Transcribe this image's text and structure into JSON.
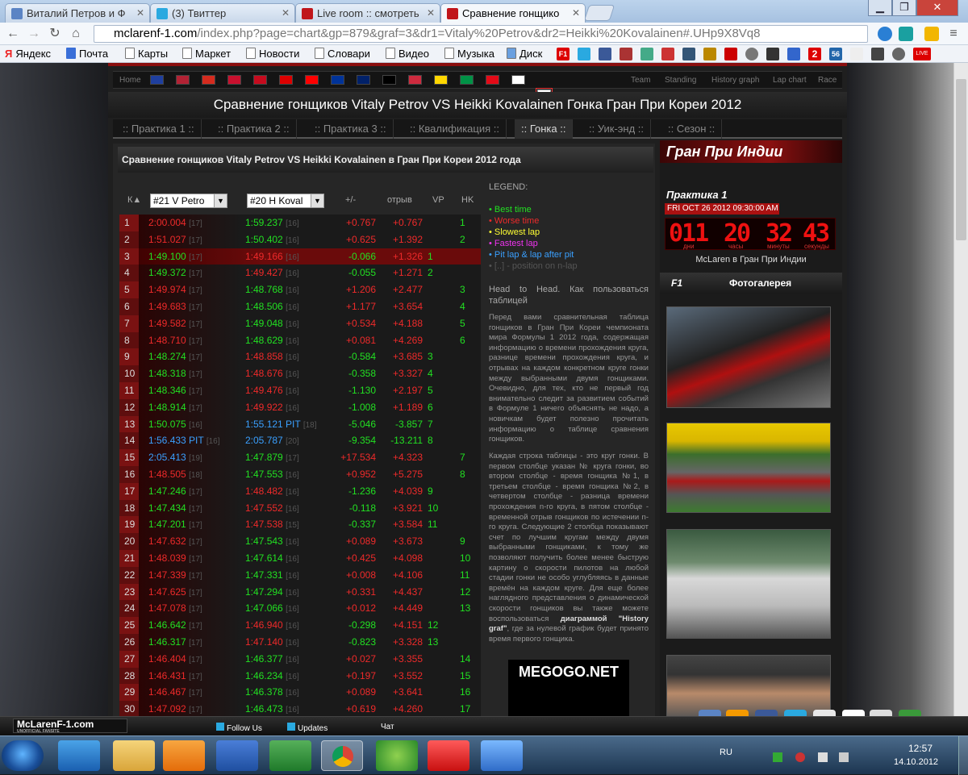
{
  "browser": {
    "tabs": [
      {
        "title": "Виталий Петров и Ф",
        "color": "#5b84c4"
      },
      {
        "title": "(3) Твиттер",
        "color": "#2aa9e0"
      },
      {
        "title": "Live room :: смотреть",
        "color": "#c0161b"
      },
      {
        "title": "Сравнение гонщико",
        "color": "#c0161b"
      }
    ],
    "url_host": "mclarenf-1.com",
    "url_path": "/index.php?page=chart&gp=879&graf=3&dr1=Vitaly%20Petrov&dr2=Heikki%20Kovalainen#.UHp9X8Vq8",
    "bookmarks": [
      "Яндекс",
      "Почта",
      "Карты",
      "Маркет",
      "Новости",
      "Словари",
      "Видео",
      "Музыка",
      "Диск"
    ],
    "bm_icons": [
      "F1",
      "2",
      "56",
      "LIVE"
    ]
  },
  "site": {
    "menu_left": "Home",
    "menu_right": [
      "Team",
      "Standing",
      "History graph",
      "Lap chart",
      "Race"
    ],
    "flag_colors": [
      "#1f3f9f",
      "#b22234",
      "#d52b1e",
      "#c8102e",
      "#c60b1e",
      "#dd0000",
      "#ff0000",
      "#003399",
      "#012169",
      "#000000",
      "#cd2a3e",
      "#ffd700",
      "#009246",
      "#e30a17",
      "#ffffff",
      "#ffffff"
    ],
    "title": "Сравнение гонщиков Vitaly Petrov VS Heikki Kovalainen Гонка Гран При Кореи 2012",
    "sessions": [
      ":: Практика 1 ::",
      ":: Практика 2 ::",
      ":: Практика 3 ::",
      ":: Квалификация ::",
      ":: Гонка ::",
      ":: Уик-энд ::",
      ":: Сезон ::"
    ],
    "content_header": "Сравнение гонщиков Vitaly Petrov VS Heikki Kovalainen в Гран При Кореи 2012 года"
  },
  "table": {
    "col_k": "К",
    "driver1": "#21 V Petro",
    "driver2": "#20 H Koval",
    "col_diff": "+/-",
    "col_gap": "отрыв",
    "col_vp": "VP",
    "col_hk": "HK",
    "rows": [
      {
        "k": "1",
        "t1": "2:00.004",
        "p1": "[17]",
        "c1": "r",
        "t2": "1:59.237",
        "p2": "[16]",
        "c2": "g",
        "d": "+0.767",
        "dc": "r",
        "g": "+0.767",
        "gc": "r",
        "vp": "",
        "hk": "1"
      },
      {
        "k": "2",
        "t1": "1:51.027",
        "p1": "[17]",
        "c1": "r",
        "t2": "1:50.402",
        "p2": "[16]",
        "c2": "g",
        "d": "+0.625",
        "dc": "r",
        "g": "+1.392",
        "gc": "r",
        "vp": "",
        "hk": "2"
      },
      {
        "k": "3",
        "t1": "1:49.100",
        "p1": "[17]",
        "c1": "g",
        "t2": "1:49.166",
        "p2": "[16]",
        "c2": "r",
        "d": "-0.066",
        "dc": "g",
        "g": "+1.326",
        "gc": "r",
        "vp": "1",
        "hk": "",
        "hl": true
      },
      {
        "k": "4",
        "t1": "1:49.372",
        "p1": "[17]",
        "c1": "g",
        "t2": "1:49.427",
        "p2": "[16]",
        "c2": "r",
        "d": "-0.055",
        "dc": "g",
        "g": "+1.271",
        "gc": "r",
        "vp": "2",
        "hk": ""
      },
      {
        "k": "5",
        "t1": "1:49.974",
        "p1": "[17]",
        "c1": "r",
        "t2": "1:48.768",
        "p2": "[16]",
        "c2": "g",
        "d": "+1.206",
        "dc": "r",
        "g": "+2.477",
        "gc": "r",
        "vp": "",
        "hk": "3"
      },
      {
        "k": "6",
        "t1": "1:49.683",
        "p1": "[17]",
        "c1": "r",
        "t2": "1:48.506",
        "p2": "[16]",
        "c2": "g",
        "d": "+1.177",
        "dc": "r",
        "g": "+3.654",
        "gc": "r",
        "vp": "",
        "hk": "4"
      },
      {
        "k": "7",
        "t1": "1:49.582",
        "p1": "[17]",
        "c1": "r",
        "t2": "1:49.048",
        "p2": "[16]",
        "c2": "g",
        "d": "+0.534",
        "dc": "r",
        "g": "+4.188",
        "gc": "r",
        "vp": "",
        "hk": "5"
      },
      {
        "k": "8",
        "t1": "1:48.710",
        "p1": "[17]",
        "c1": "r",
        "t2": "1:48.629",
        "p2": "[16]",
        "c2": "g",
        "d": "+0.081",
        "dc": "r",
        "g": "+4.269",
        "gc": "r",
        "vp": "",
        "hk": "6"
      },
      {
        "k": "9",
        "t1": "1:48.274",
        "p1": "[17]",
        "c1": "g",
        "t2": "1:48.858",
        "p2": "[16]",
        "c2": "r",
        "d": "-0.584",
        "dc": "g",
        "g": "+3.685",
        "gc": "r",
        "vp": "3",
        "hk": ""
      },
      {
        "k": "10",
        "t1": "1:48.318",
        "p1": "[17]",
        "c1": "g",
        "t2": "1:48.676",
        "p2": "[16]",
        "c2": "r",
        "d": "-0.358",
        "dc": "g",
        "g": "+3.327",
        "gc": "r",
        "vp": "4",
        "hk": ""
      },
      {
        "k": "11",
        "t1": "1:48.346",
        "p1": "[17]",
        "c1": "g",
        "t2": "1:49.476",
        "p2": "[16]",
        "c2": "r",
        "d": "-1.130",
        "dc": "g",
        "g": "+2.197",
        "gc": "r",
        "vp": "5",
        "hk": ""
      },
      {
        "k": "12",
        "t1": "1:48.914",
        "p1": "[17]",
        "c1": "g",
        "t2": "1:49.922",
        "p2": "[16]",
        "c2": "r",
        "d": "-1.008",
        "dc": "g",
        "g": "+1.189",
        "gc": "r",
        "vp": "6",
        "hk": ""
      },
      {
        "k": "13",
        "t1": "1:50.075",
        "p1": "[16]",
        "c1": "g",
        "t2": "1:55.121 PIT",
        "p2": "[18]",
        "c2": "b",
        "d": "-5.046",
        "dc": "g",
        "g": "-3.857",
        "gc": "g",
        "vp": "7",
        "hk": ""
      },
      {
        "k": "14",
        "t1": "1:56.433 PIT",
        "p1": "[16]",
        "c1": "b",
        "t2": "2:05.787",
        "p2": "[20]",
        "c2": "b",
        "d": "-9.354",
        "dc": "g",
        "g": "-13.211",
        "gc": "g",
        "vp": "8",
        "hk": ""
      },
      {
        "k": "15",
        "t1": "2:05.413",
        "p1": "[19]",
        "c1": "b",
        "t2": "1:47.879",
        "p2": "[17]",
        "c2": "g",
        "d": "+17.534",
        "dc": "r",
        "g": "+4.323",
        "gc": "r",
        "vp": "",
        "hk": "7"
      },
      {
        "k": "16",
        "t1": "1:48.505",
        "p1": "[18]",
        "c1": "r",
        "t2": "1:47.553",
        "p2": "[16]",
        "c2": "g",
        "d": "+0.952",
        "dc": "r",
        "g": "+5.275",
        "gc": "r",
        "vp": "",
        "hk": "8"
      },
      {
        "k": "17",
        "t1": "1:47.246",
        "p1": "[17]",
        "c1": "g",
        "t2": "1:48.482",
        "p2": "[16]",
        "c2": "r",
        "d": "-1.236",
        "dc": "g",
        "g": "+4.039",
        "gc": "r",
        "vp": "9",
        "hk": ""
      },
      {
        "k": "18",
        "t1": "1:47.434",
        "p1": "[17]",
        "c1": "g",
        "t2": "1:47.552",
        "p2": "[16]",
        "c2": "r",
        "d": "-0.118",
        "dc": "g",
        "g": "+3.921",
        "gc": "r",
        "vp": "10",
        "hk": ""
      },
      {
        "k": "19",
        "t1": "1:47.201",
        "p1": "[17]",
        "c1": "g",
        "t2": "1:47.538",
        "p2": "[15]",
        "c2": "r",
        "d": "-0.337",
        "dc": "g",
        "g": "+3.584",
        "gc": "r",
        "vp": "11",
        "hk": ""
      },
      {
        "k": "20",
        "t1": "1:47.632",
        "p1": "[17]",
        "c1": "r",
        "t2": "1:47.543",
        "p2": "[16]",
        "c2": "g",
        "d": "+0.089",
        "dc": "r",
        "g": "+3.673",
        "gc": "r",
        "vp": "",
        "hk": "9"
      },
      {
        "k": "21",
        "t1": "1:48.039",
        "p1": "[17]",
        "c1": "r",
        "t2": "1:47.614",
        "p2": "[16]",
        "c2": "g",
        "d": "+0.425",
        "dc": "r",
        "g": "+4.098",
        "gc": "r",
        "vp": "",
        "hk": "10"
      },
      {
        "k": "22",
        "t1": "1:47.339",
        "p1": "[17]",
        "c1": "r",
        "t2": "1:47.331",
        "p2": "[16]",
        "c2": "g",
        "d": "+0.008",
        "dc": "r",
        "g": "+4.106",
        "gc": "r",
        "vp": "",
        "hk": "11"
      },
      {
        "k": "23",
        "t1": "1:47.625",
        "p1": "[17]",
        "c1": "r",
        "t2": "1:47.294",
        "p2": "[16]",
        "c2": "g",
        "d": "+0.331",
        "dc": "r",
        "g": "+4.437",
        "gc": "r",
        "vp": "",
        "hk": "12"
      },
      {
        "k": "24",
        "t1": "1:47.078",
        "p1": "[17]",
        "c1": "r",
        "t2": "1:47.066",
        "p2": "[16]",
        "c2": "g",
        "d": "+0.012",
        "dc": "r",
        "g": "+4.449",
        "gc": "r",
        "vp": "",
        "hk": "13"
      },
      {
        "k": "25",
        "t1": "1:46.642",
        "p1": "[17]",
        "c1": "g",
        "t2": "1:46.940",
        "p2": "[16]",
        "c2": "r",
        "d": "-0.298",
        "dc": "g",
        "g": "+4.151",
        "gc": "r",
        "vp": "12",
        "hk": ""
      },
      {
        "k": "26",
        "t1": "1:46.317",
        "p1": "[17]",
        "c1": "g",
        "t2": "1:47.140",
        "p2": "[16]",
        "c2": "r",
        "d": "-0.823",
        "dc": "g",
        "g": "+3.328",
        "gc": "r",
        "vp": "13",
        "hk": ""
      },
      {
        "k": "27",
        "t1": "1:46.404",
        "p1": "[17]",
        "c1": "r",
        "t2": "1:46.377",
        "p2": "[16]",
        "c2": "g",
        "d": "+0.027",
        "dc": "r",
        "g": "+3.355",
        "gc": "r",
        "vp": "",
        "hk": "14"
      },
      {
        "k": "28",
        "t1": "1:46.431",
        "p1": "[17]",
        "c1": "r",
        "t2": "1:46.234",
        "p2": "[16]",
        "c2": "g",
        "d": "+0.197",
        "dc": "r",
        "g": "+3.552",
        "gc": "r",
        "vp": "",
        "hk": "15"
      },
      {
        "k": "29",
        "t1": "1:46.467",
        "p1": "[17]",
        "c1": "r",
        "t2": "1:46.378",
        "p2": "[16]",
        "c2": "g",
        "d": "+0.089",
        "dc": "r",
        "g": "+3.641",
        "gc": "r",
        "vp": "",
        "hk": "16"
      },
      {
        "k": "30",
        "t1": "1:47.092",
        "p1": "[17]",
        "c1": "r",
        "t2": "1:46.473",
        "p2": "[16]",
        "c2": "g",
        "d": "+0.619",
        "dc": "r",
        "g": "+4.260",
        "gc": "r",
        "vp": "",
        "hk": "17"
      }
    ]
  },
  "legend": {
    "title": "LEGEND:",
    "items": [
      {
        "text": "• Best time",
        "color": "#22e022"
      },
      {
        "text": "• Worse time",
        "color": "#ee2a2a"
      },
      {
        "text": "• Slowest lap",
        "color": "#ffff33"
      },
      {
        "text": "• Fastest lap",
        "color": "#ee33ee"
      },
      {
        "text": "• Pit lap & lap after pit",
        "color": "#3aa0ff"
      },
      {
        "text": "• [..] - position on n-lap",
        "color": "#555555"
      }
    ],
    "head": "Head to Head. Как пользоваться таблицей",
    "p1": "Перед вами сравнительная таблица гонщиков в Гран При Кореи чемпионата мира Формулы 1 2012 года, содержащая информацию о времени прохождения круга, разнице времени прохождения круга, и отрывах на каждом конкретном круге гонки между выбранными двумя гонщиками. Очевидно, для тех, кто не первый год внимательно следит за развитием событий в Формуле 1 ничего объяснять не надо, а новичкам будет полезно прочитать информацию о таблице сравнения гонщиков.",
    "p2": "Каждая строка таблицы - это круг гонки. В первом столбце указан № круга гонки, во втором столбце - время гонщика №1, в третьем столбце - время гонщика №2, в четвертом столбце - разница времени прохождения n-го круга, в пятом столбце - временной отрыв гонщиков по истечении n-го круга. Следующие 2 столбца показывают счет по лучшим кругам между двумя выбранными гонщиками, к тому же позволяют получить более менее быструю картину о скорости пилотов на любой стадии гонки не особо углубляясь в данные времён на каждом круге. Для еще более наглядного представления о динамической скорости гонщиков вы также можете воспользоваться",
    "p2b": "диаграммой \"History graf\"",
    "p2c": ", где за нулевой график будет принято время первого гонщика.",
    "ad": "MEGOGO.NET"
  },
  "sidebar": {
    "title": "Гран При Индии",
    "session": "Практика 1",
    "date": "FRI OCT 26 2012 09:30:00 AM",
    "digits": [
      "011",
      "20",
      "32",
      "43"
    ],
    "digit_labels": [
      "дни",
      "часы",
      "минуты",
      "секунды"
    ],
    "text": "McLaren в Гран При Индии",
    "gallery_logo": "F1",
    "gallery": "Фотогалерея"
  },
  "statusbar": {
    "logo": "McLarenF-1.com",
    "logo_sub": "UNOFFICIAL FANSITE",
    "follow": "Follow Us",
    "updates": "Updates",
    "chat": "Чат"
  },
  "social": [
    "B",
    "OK",
    "f",
    "t",
    "✎",
    "XA",
    "✉",
    "share"
  ],
  "taskbar": {
    "lang": "RU",
    "time": "12:57",
    "date": "14.10.2012"
  }
}
